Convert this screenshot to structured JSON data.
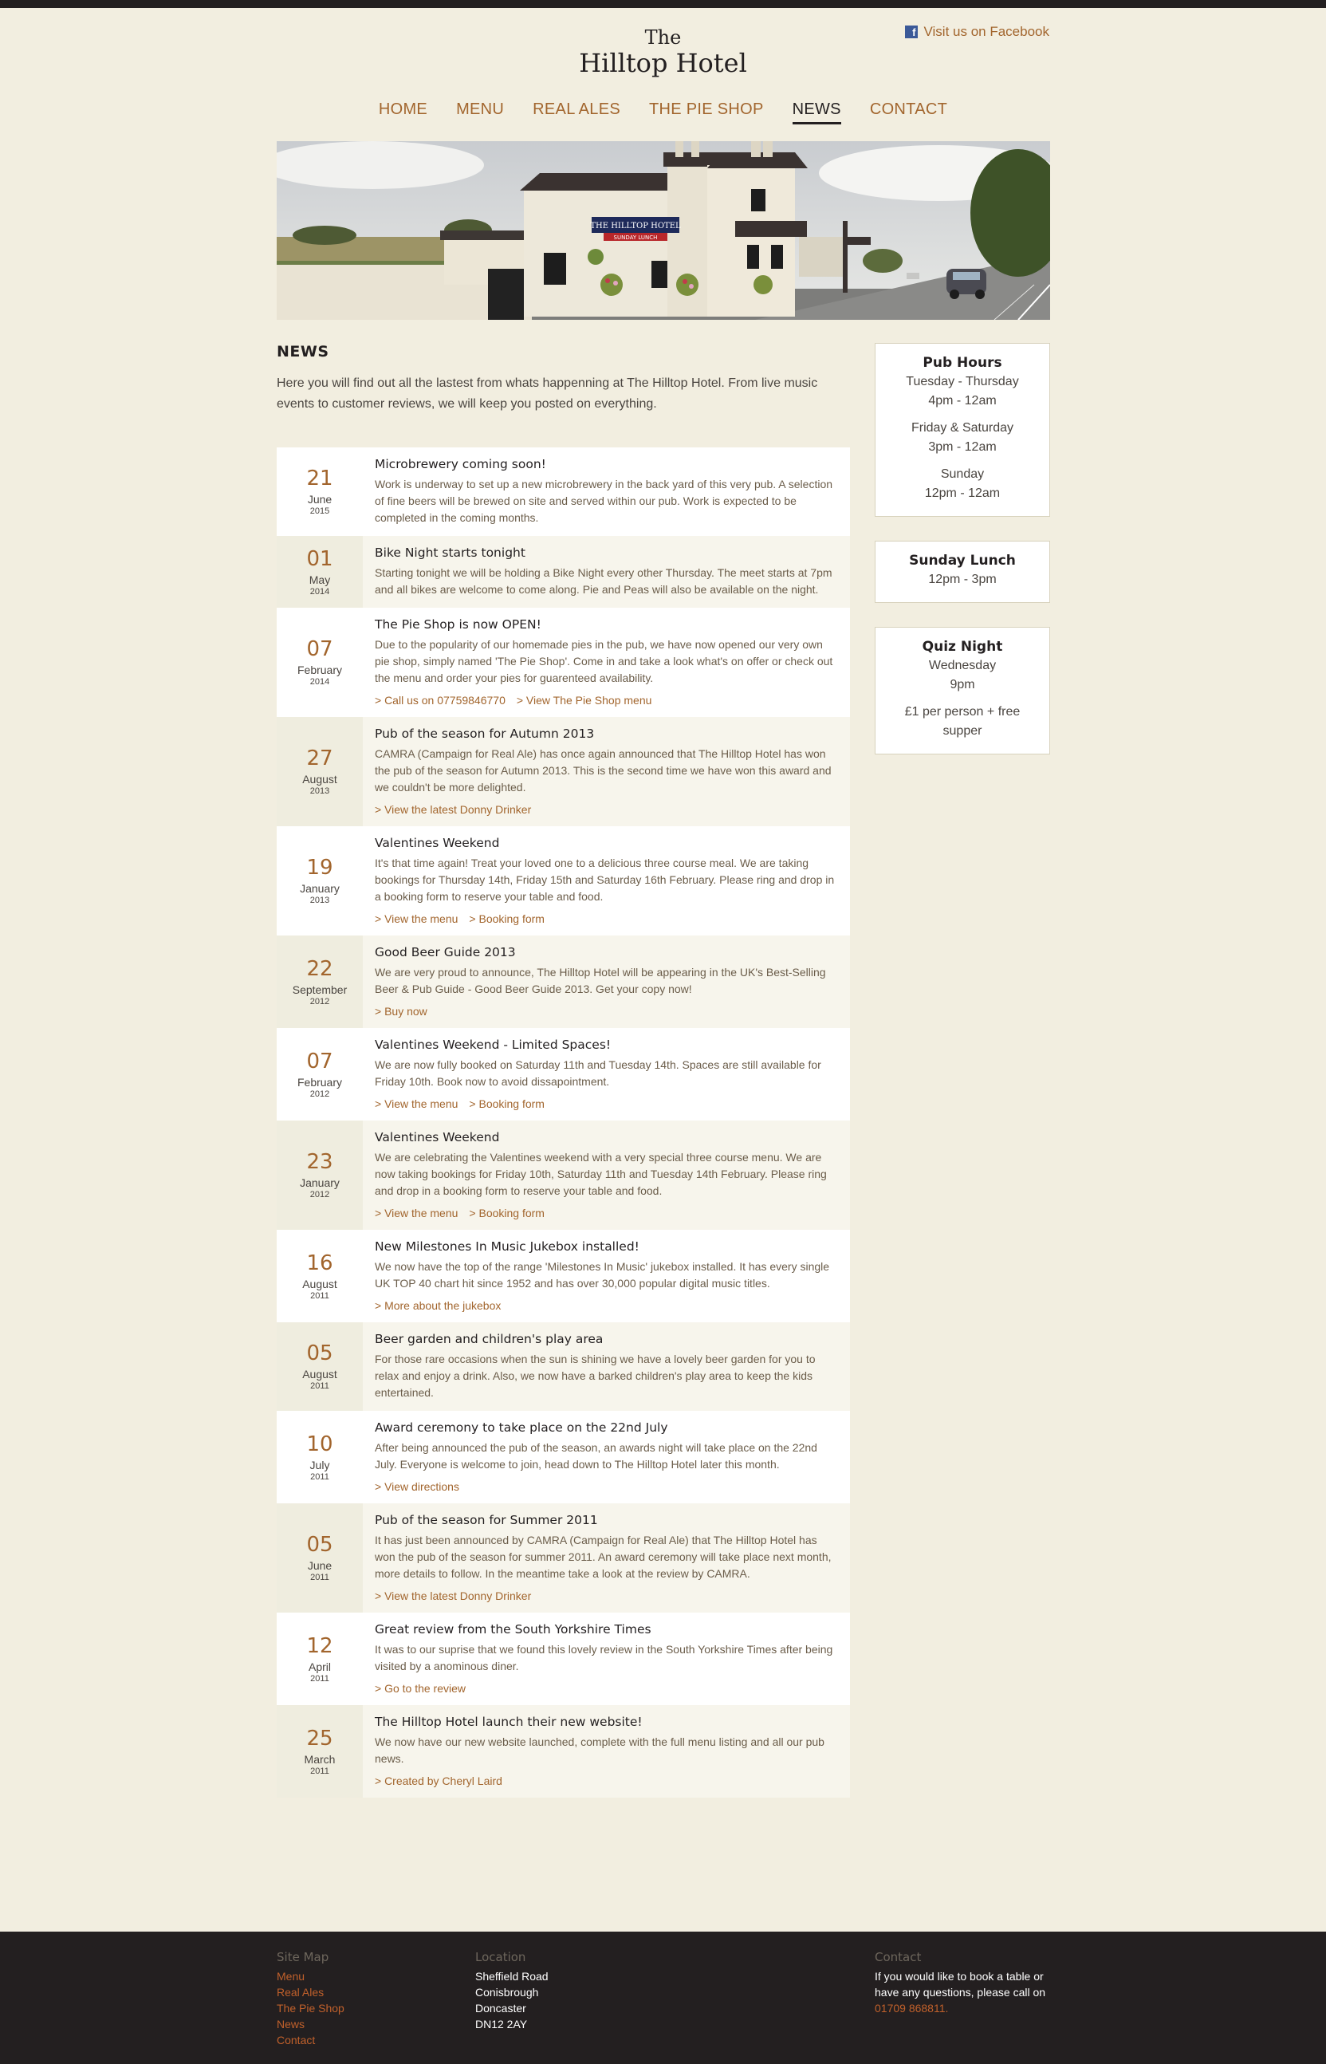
{
  "header": {
    "facebook_label": "Visit us on Facebook",
    "logo_the": "The",
    "logo_name": "Hilltop Hotel"
  },
  "nav": {
    "items": [
      {
        "label": "HOME"
      },
      {
        "label": "MENU"
      },
      {
        "label": "REAL ALES"
      },
      {
        "label": "THE PIE SHOP"
      },
      {
        "label": "NEWS",
        "active": true
      },
      {
        "label": "CONTACT"
      }
    ]
  },
  "banner": {
    "sign_text": "THE HILLTOP HOTEL",
    "sign_sub": "SUNDAY LUNCH"
  },
  "main": {
    "title": "NEWS",
    "intro": "Here you will find out all the lastest from whats happenning at The Hilltop Hotel. From live music events to customer reviews, we will keep you posted on everything."
  },
  "news": [
    {
      "day": "21",
      "month": "June",
      "year": "2015",
      "title": "Microbrewery coming soon!",
      "body": "Work is underway to set up a new microbrewery in the back yard of this very pub. A selection of fine beers will be brewed on site and served within our pub. Work is expected to be completed in the coming months.",
      "links": []
    },
    {
      "day": "01",
      "month": "May",
      "year": "2014",
      "title": "Bike Night starts tonight",
      "body": "Starting tonight we will be holding a Bike Night every other Thursday. The meet starts at 7pm and all bikes are welcome to come along. Pie and Peas will also be available on the night.",
      "links": []
    },
    {
      "day": "07",
      "month": "February",
      "year": "2014",
      "title": "The Pie Shop is now OPEN!",
      "body": "Due to the popularity of our homemade pies in the pub, we have now opened our very own pie shop, simply named 'The Pie Shop'. Come in and take a look what's on offer or check out the menu and order your pies for guarenteed availability.",
      "links": [
        "> Call us on 07759846770",
        "> View The Pie Shop menu"
      ]
    },
    {
      "day": "27",
      "month": "August",
      "year": "2013",
      "title": "Pub of the season for Autumn 2013",
      "body": "CAMRA (Campaign for Real Ale) has once again announced that The Hilltop Hotel has won the pub of the season for Autumn 2013. This is the second time we have won this award and we couldn't be more delighted.",
      "links": [
        "> View the latest Donny Drinker"
      ]
    },
    {
      "day": "19",
      "month": "January",
      "year": "2013",
      "title": "Valentines Weekend",
      "body": "It's that time again! Treat your loved one to a delicious three course meal. We are taking bookings for Thursday 14th, Friday 15th and Saturday 16th February. Please ring and drop in a booking form to reserve your table and food.",
      "links": [
        "> View the menu",
        "> Booking form"
      ]
    },
    {
      "day": "22",
      "month": "September",
      "year": "2012",
      "title": "Good Beer Guide 2013",
      "body": "We are very proud to announce, The Hilltop Hotel will be appearing in the UK's Best-Selling Beer & Pub Guide - Good Beer Guide 2013. Get your copy now!",
      "links": [
        "> Buy now"
      ]
    },
    {
      "day": "07",
      "month": "February",
      "year": "2012",
      "title": "Valentines Weekend - Limited Spaces!",
      "body": "We are now fully booked on Saturday 11th and Tuesday 14th. Spaces are still available for Friday 10th. Book now to avoid dissapointment.",
      "links": [
        "> View the menu",
        "> Booking form"
      ]
    },
    {
      "day": "23",
      "month": "January",
      "year": "2012",
      "title": "Valentines Weekend",
      "body": "We are celebrating the Valentines weekend with a very special three course menu. We are now taking bookings for Friday 10th, Saturday 11th and Tuesday 14th February. Please ring and drop in a booking form to reserve your table and food.",
      "links": [
        "> View the menu",
        "> Booking form"
      ]
    },
    {
      "day": "16",
      "month": "August",
      "year": "2011",
      "title": "New Milestones In Music Jukebox installed!",
      "body": "We now have the top of the range 'Milestones In Music' jukebox installed. It has every single UK TOP 40 chart hit since 1952 and has over 30,000 popular digital music titles.",
      "links": [
        "> More about the jukebox"
      ]
    },
    {
      "day": "05",
      "month": "August",
      "year": "2011",
      "title": "Beer garden and children's play area",
      "body": "For those rare occasions when the sun is shining we have a lovely beer garden for you to relax and enjoy a drink. Also, we now have a barked children's play area to keep the kids entertained.",
      "links": []
    },
    {
      "day": "10",
      "month": "July",
      "year": "2011",
      "title": "Award ceremony to take place on the 22nd July",
      "body": "After being announced the pub of the season, an awards night will take place on the 22nd July. Everyone is welcome to join, head down to The Hilltop Hotel later this month.",
      "links": [
        "> View directions"
      ]
    },
    {
      "day": "05",
      "month": "June",
      "year": "2011",
      "title": "Pub of the season for Summer 2011",
      "body": "It has just been announced by CAMRA (Campaign for Real Ale) that The Hilltop Hotel has won the pub of the season for summer 2011. An award ceremony will take place next month, more details to follow. In the meantime take a look at the review by CAMRA.",
      "links": [
        "> View the latest Donny Drinker"
      ]
    },
    {
      "day": "12",
      "month": "April",
      "year": "2011",
      "title": "Great review from the South Yorkshire Times",
      "body": "It was to our suprise that we found this lovely review in the South Yorkshire Times after being visited by a anominous diner.",
      "links": [
        "> Go to the review"
      ]
    },
    {
      "day": "25",
      "month": "March",
      "year": "2011",
      "title": "The Hilltop Hotel launch their new website!",
      "body": "We now have our new website launched, complete with the full menu listing and all our pub news.",
      "links": [
        "> Created by Cheryl Laird"
      ]
    }
  ],
  "sidebar": {
    "pub_hours": {
      "title": "Pub Hours",
      "groups": [
        [
          "Tuesday - Thursday",
          "4pm - 12am"
        ],
        [
          "Friday & Saturday",
          "3pm - 12am"
        ],
        [
          "Sunday",
          "12pm - 12am"
        ]
      ]
    },
    "sunday_lunch": {
      "title": "Sunday Lunch",
      "groups": [
        [
          "12pm - 3pm"
        ]
      ]
    },
    "quiz_night": {
      "title": "Quiz Night",
      "groups": [
        [
          "Wednesday",
          "9pm"
        ],
        [
          "£1 per person + free",
          "supper"
        ]
      ]
    }
  },
  "footer": {
    "sitemap_title": "Site Map",
    "sitemap_links": [
      "Menu",
      "Real Ales",
      "The Pie Shop",
      "News",
      "Contact"
    ],
    "location_title": "Location",
    "location_lines": [
      "Sheffield Road",
      "Conisbrough",
      "Doncaster",
      "DN12 2AY"
    ],
    "contact_title": "Contact",
    "contact_lines": [
      "If you would like to book a table or",
      "have any questions, please call on"
    ],
    "contact_phone": "01709 868811."
  }
}
